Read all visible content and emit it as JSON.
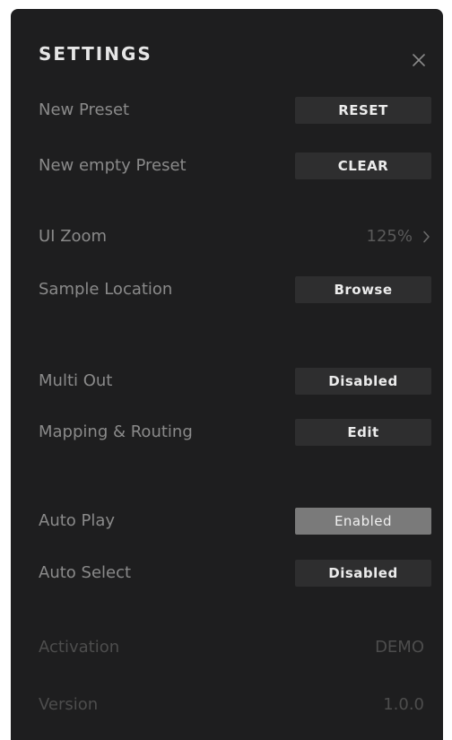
{
  "settings": {
    "title": "SETTINGS",
    "close_icon": "close-icon",
    "rows": {
      "new_preset": {
        "label": "New Preset",
        "button": "RESET"
      },
      "new_empty_preset": {
        "label": "New empty Preset",
        "button": "CLEAR"
      },
      "ui_zoom": {
        "label": "UI Zoom",
        "value": "125%",
        "icon": "chevron-right-icon"
      },
      "sample_location": {
        "label": "Sample Location",
        "button": "Browse"
      },
      "multi_out": {
        "label": "Multi Out",
        "button": "Disabled"
      },
      "mapping_routing": {
        "label": "Mapping & Routing",
        "button": "Edit"
      },
      "auto_play": {
        "label": "Auto Play",
        "button": "Enabled"
      },
      "auto_select": {
        "label": "Auto Select",
        "button": "Disabled"
      },
      "activation": {
        "label": "Activation",
        "value": "DEMO"
      },
      "version": {
        "label": "Version",
        "value": "1.0.0"
      }
    }
  },
  "colors": {
    "panel_bg": "#1e1e1f",
    "title": "#e6e6e6",
    "label": "#8a8a8a",
    "label_dim": "#4d4d4d",
    "button_bg": "#2e2e2f",
    "button_active_bg": "#7a7a7a",
    "button_text": "#ececec"
  }
}
